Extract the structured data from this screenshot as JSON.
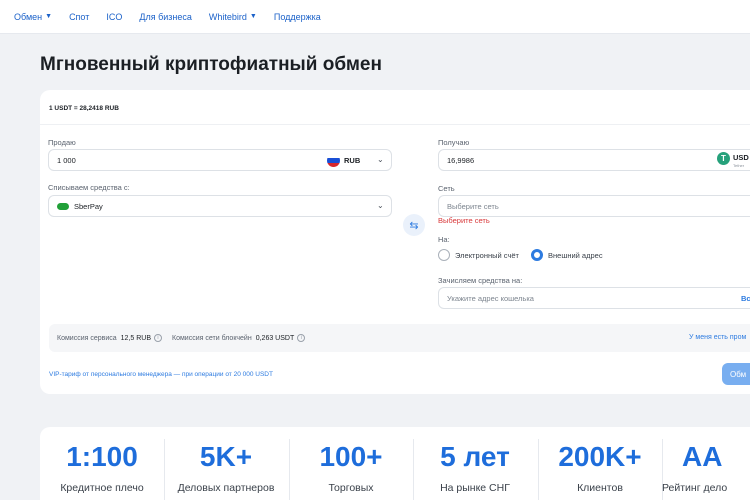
{
  "nav": {
    "items": [
      {
        "label": "Обмен",
        "has_dropdown": true
      },
      {
        "label": "Спот",
        "has_dropdown": false
      },
      {
        "label": "ICO",
        "has_dropdown": false
      },
      {
        "label": "Для бизнеса",
        "has_dropdown": false
      },
      {
        "label": "Whitebird",
        "has_dropdown": true
      },
      {
        "label": "Поддержка",
        "has_dropdown": false
      }
    ]
  },
  "page": {
    "title": "Мгновенный криптофиатный обмен"
  },
  "exchange": {
    "rate": "1 USDT = 28,2418 RUB",
    "sell": {
      "label": "Продаю",
      "amount": "1 000",
      "currency": "RUB"
    },
    "debit": {
      "label": "Списываем средства с:",
      "method": "SberPay"
    },
    "receive": {
      "label": "Получаю",
      "amount": "16,9986",
      "currency": "USD",
      "currency_sub": "Tether"
    },
    "network": {
      "label": "Сеть",
      "placeholder": "Выберите сеть",
      "error": "Выберите сеть"
    },
    "to": {
      "label": "На:",
      "options": [
        {
          "label": "Электронный счёт",
          "selected": false
        },
        {
          "label": "Внешний адрес",
          "selected": true
        }
      ]
    },
    "credit": {
      "label": "Зачисляем средства на:",
      "placeholder": "Укажите адрес кошелька",
      "action": "Вс"
    },
    "fees": {
      "service_label": "Комиссия сервиса",
      "service_value": "12,5 RUB",
      "network_label": "Комиссия сети блокчейн",
      "network_value": "0,263 USDT"
    },
    "promo_link": "У меня есть пром",
    "vip_text": "VIP-тариф от персонального менеджера — при операции от 20 000 USDT",
    "submit_label": "Обм"
  },
  "stats": [
    {
      "value": "1:100",
      "label": "Кредитное плечо"
    },
    {
      "value": "5K+",
      "label": "Деловых партнеров"
    },
    {
      "value": "100+",
      "label": "Торговых"
    },
    {
      "value": "5 лет",
      "label": "На рынке СНГ"
    },
    {
      "value": "200K+",
      "label": "Клиентов"
    },
    {
      "value": "AA",
      "label": "Рейтинг дело"
    }
  ],
  "colors": {
    "accent": "#1e6ddb",
    "link": "#2d7be0",
    "error": "#d8383a",
    "tether": "#26a17b",
    "sber": "#21a038"
  }
}
